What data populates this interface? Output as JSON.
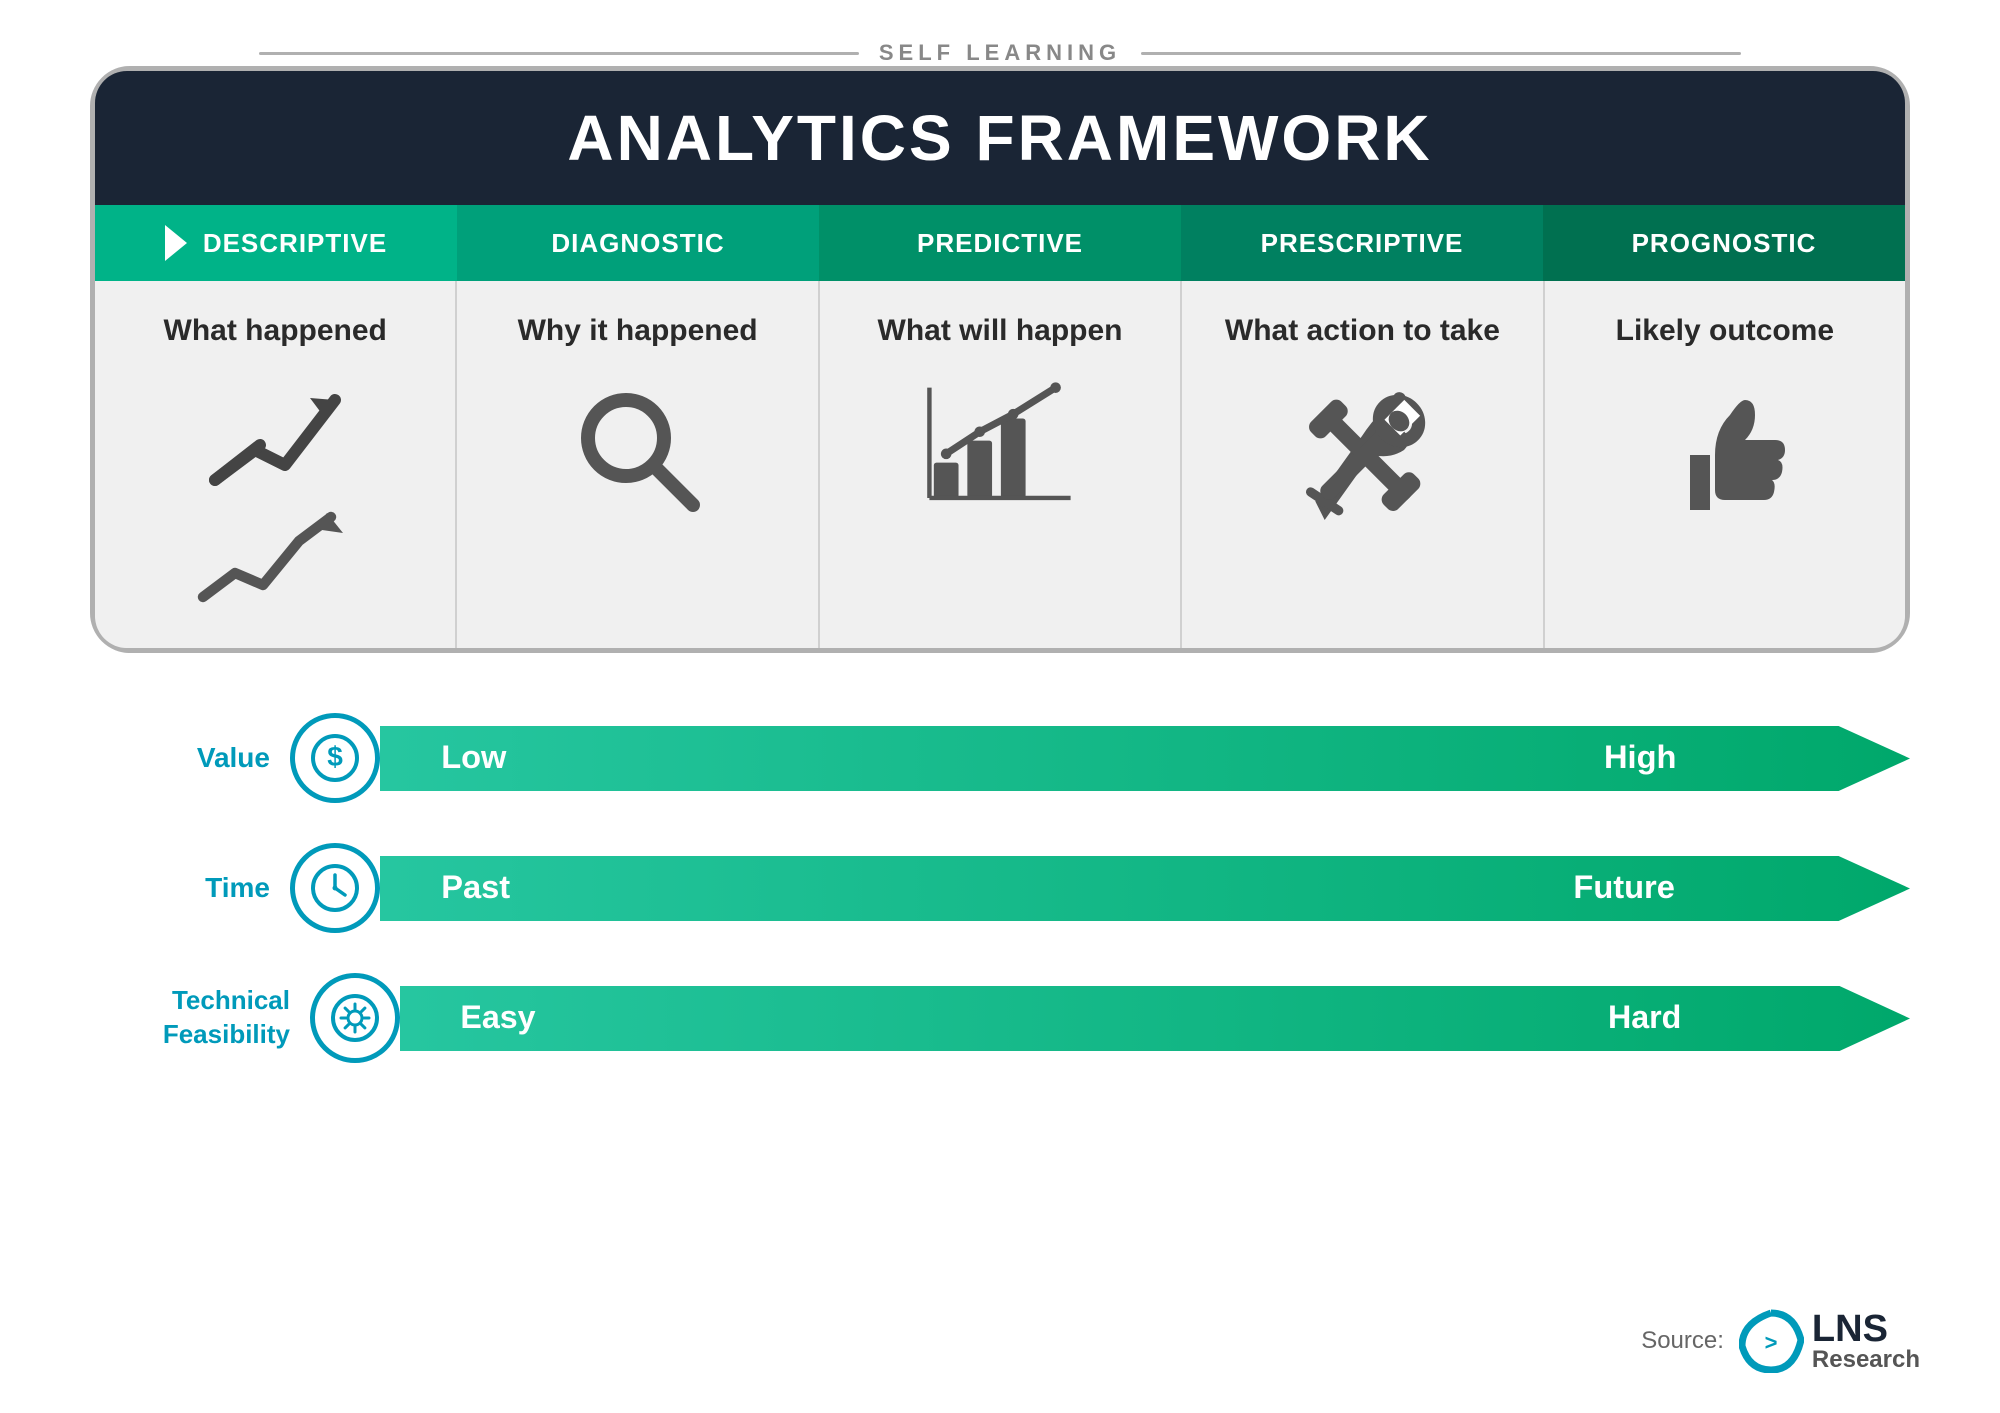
{
  "page": {
    "self_learning_label": "SELF LEARNING",
    "framework_title": "ANALYTICS FRAMEWORK",
    "columns": [
      {
        "id": "descriptive",
        "header": "DESCRIPTIVE",
        "description": "What happened",
        "icon_type": "trend",
        "color": "#00b896"
      },
      {
        "id": "diagnostic",
        "header": "DIAGNOSTIC",
        "description": "Why it happened",
        "icon_type": "search",
        "color": "#00a882"
      },
      {
        "id": "predictive",
        "header": "PREDICTIVE",
        "description": "What will happen",
        "icon_type": "chart",
        "color": "#009870"
      },
      {
        "id": "prescriptive",
        "header": "PRESCRIPTIVE",
        "description": "What action to take",
        "icon_type": "wrench",
        "color": "#008860"
      },
      {
        "id": "prognostic",
        "header": "PROGNOSTIC",
        "description": "Likely outcome",
        "icon_type": "thumbsup",
        "color": "#007850"
      }
    ],
    "arrows": [
      {
        "id": "value",
        "label": "Value",
        "icon_type": "dollar",
        "left_text": "Low",
        "right_text": "High"
      },
      {
        "id": "time",
        "label": "Time",
        "icon_type": "clock",
        "left_text": "Past",
        "right_text": "Future"
      },
      {
        "id": "technical",
        "label": "Technical Feasibility",
        "icon_type": "gear",
        "left_text": "Easy",
        "right_text": "Hard"
      }
    ],
    "source_label": "Source:",
    "lns_top": "LNS",
    "lns_bottom": "Research"
  }
}
